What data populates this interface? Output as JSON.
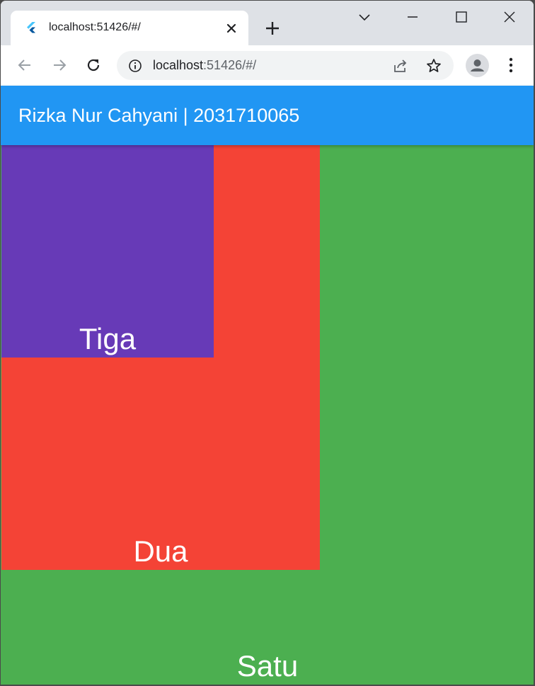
{
  "browser": {
    "tab": {
      "title": "localhost:51426/#/"
    },
    "address_bar": {
      "host": "localhost",
      "rest": ":51426/#/"
    }
  },
  "app": {
    "title": "Rizka Nur Cahyani | 2031710065",
    "boxes": [
      {
        "label": "Satu",
        "color": "#4caf50"
      },
      {
        "label": "Dua",
        "color": "#f44336"
      },
      {
        "label": "Tiga",
        "color": "#673ab7"
      }
    ],
    "appbar_color": "#2196f3"
  }
}
